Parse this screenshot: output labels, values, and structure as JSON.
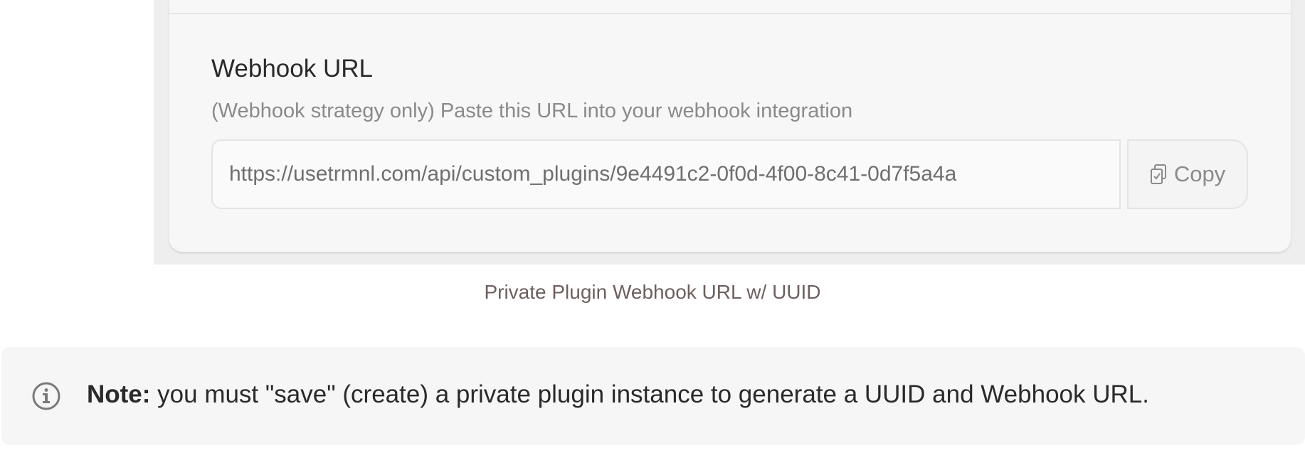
{
  "webhook_field": {
    "title": "Webhook URL",
    "help_text": "(Webhook strategy only) Paste this URL into your webhook integration",
    "url_value": "https://usetrmnl.com/api/custom_plugins/9e4491c2-0f0d-4f00-8c41-0d7f5a4a",
    "copy_label": "Copy",
    "copy_icon": "clipboard-icon"
  },
  "caption": "Private Plugin Webhook URL w/ UUID",
  "note": {
    "icon": "info-icon",
    "label": "Note:",
    "text": " you must \"save\" (create) a private plugin instance to generate a UUID and Webhook URL."
  },
  "colors": {
    "card_background": "#f7f7f7",
    "frame_background": "#eeeeee",
    "caption_color": "#6e5f5f",
    "note_background": "#f6f6f6"
  }
}
